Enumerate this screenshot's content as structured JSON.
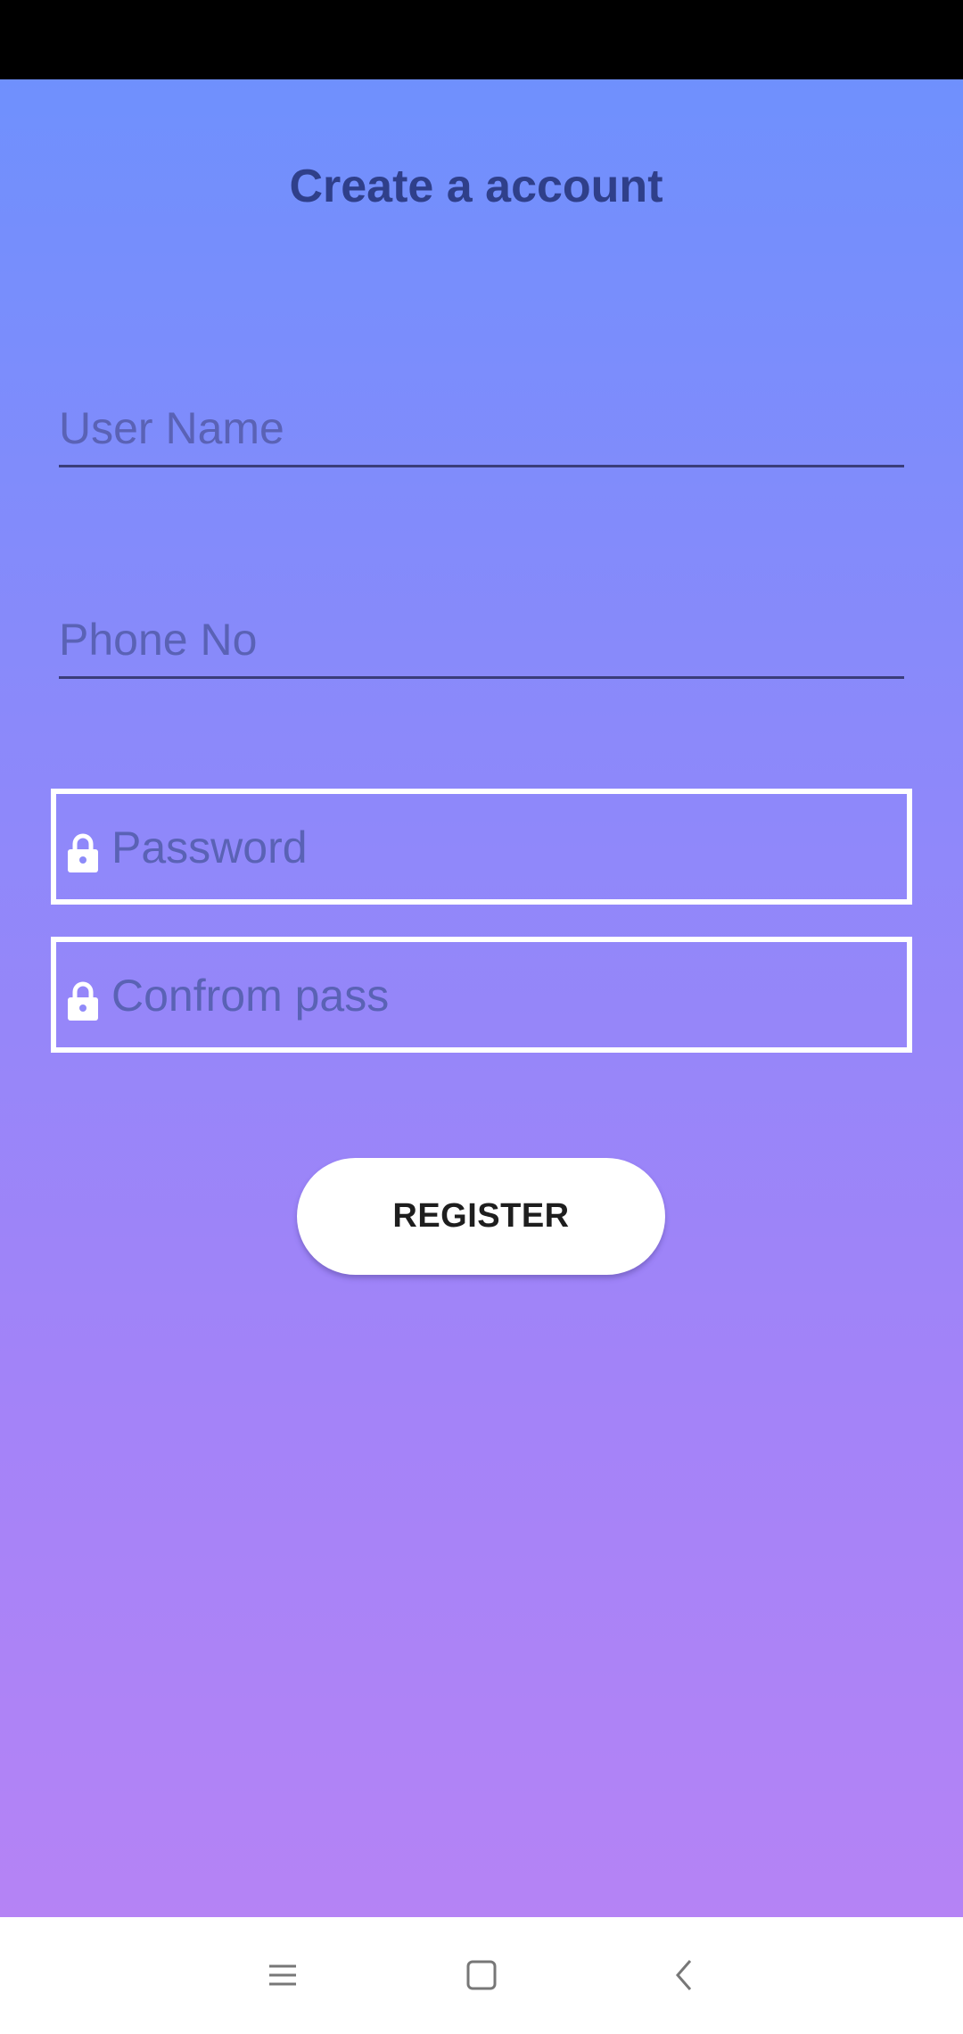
{
  "screen": {
    "title": "Create a account"
  },
  "form": {
    "username_placeholder": "User Name",
    "phone_placeholder": "Phone No",
    "password_placeholder": "Password",
    "confirm_placeholder": "Confrom pass",
    "register_label": "REGISTER"
  },
  "icons": {
    "password_icon": "lock-icon",
    "confirm_icon": "lock-icon",
    "nav_menu": "menu-icon",
    "nav_home": "home-square-icon",
    "nav_back": "back-chevron-icon"
  },
  "colors": {
    "gradient_top": "#6f90fd",
    "gradient_bottom": "#b583f5",
    "title": "#2f3f8a",
    "button_bg": "#ffffff"
  }
}
